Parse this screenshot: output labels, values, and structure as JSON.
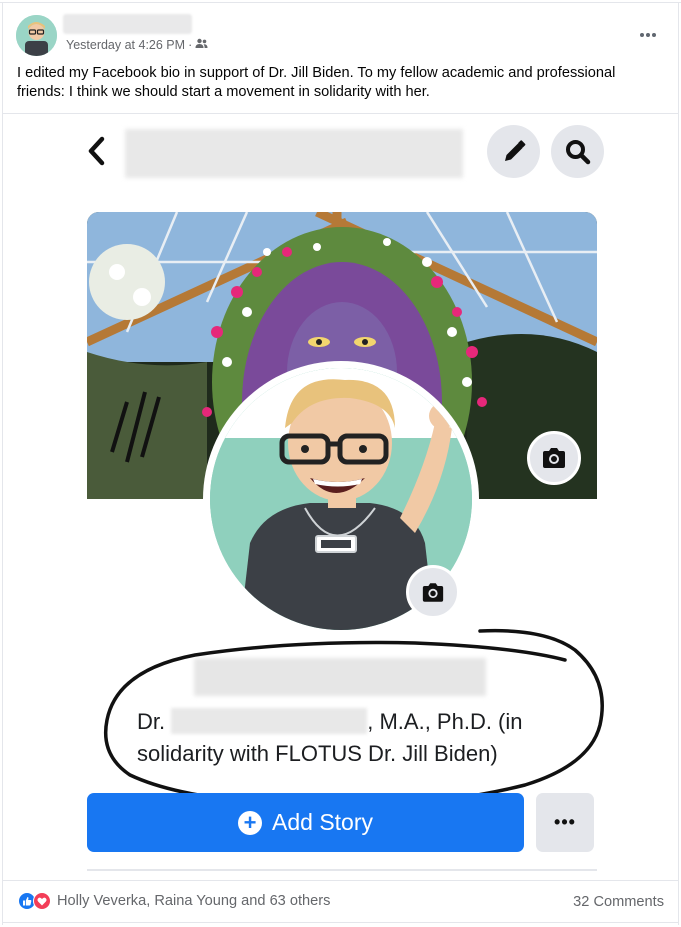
{
  "post": {
    "timestamp": "Yesterday at 4:26 PM",
    "separator": "·",
    "audience_icon": "friends-icon",
    "text": "I edited my Facebook bio in support of Dr. Jill Biden. To my fellow academic and professional friends: I think we should start a movement in solidarity with her.",
    "menu_icon": "more-horizontal-icon"
  },
  "screenshot": {
    "bio_prefix": "Dr.",
    "bio_suffix": ", M.A., Ph.D. (in",
    "bio_line2": "solidarity with FLOTUS Dr. Jill Biden)",
    "add_story_label": "Add Story",
    "more_label": "•••"
  },
  "footer": {
    "reactions_text": "Holly Veverka, Raina Young and 63 others",
    "comments_text": "32 Comments"
  },
  "colors": {
    "facebook_blue": "#1877f2",
    "love_red": "#f33e58",
    "annotation_ink": "#111111"
  }
}
